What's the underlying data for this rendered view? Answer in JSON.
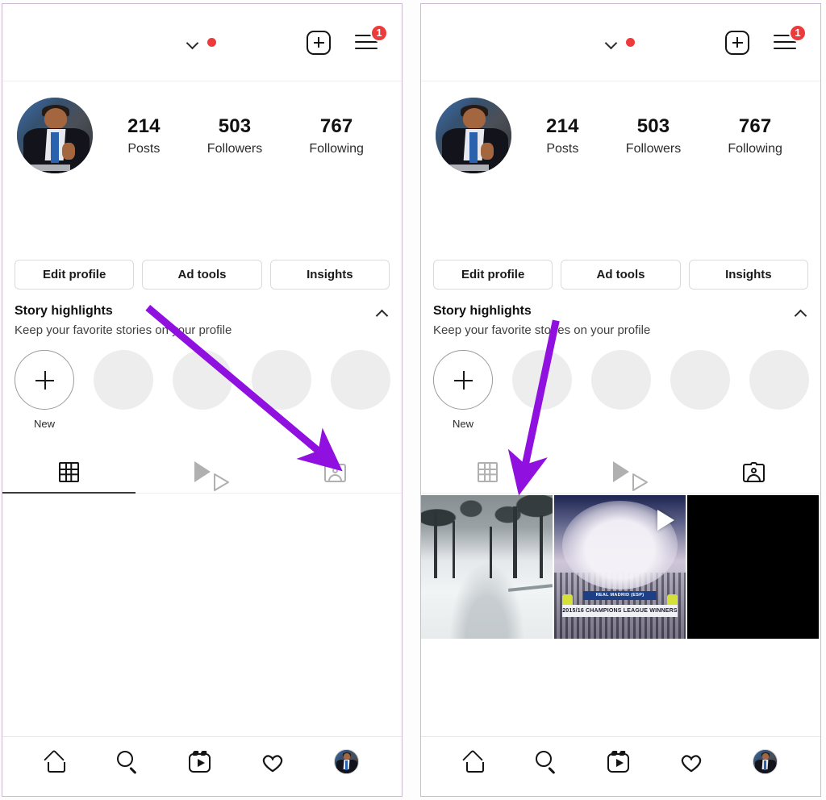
{
  "accent": {
    "arrow_purple": "#9010e0",
    "badge_red": "#ed3a3a",
    "panel_border": "#cdb8d6"
  },
  "panels": [
    {
      "id": "left",
      "topbar": {
        "chevron_icon": "chevron-down-icon",
        "story_dot_icon": "red-dot-indicator",
        "add_icon": "plus-square-icon",
        "menu_icon": "hamburger-menu-icon",
        "menu_badge": "1"
      },
      "profile": {
        "avatar_icon": "profile-avatar",
        "stats": [
          {
            "number": "214",
            "label": "Posts"
          },
          {
            "number": "503",
            "label": "Followers"
          },
          {
            "number": "767",
            "label": "Following"
          }
        ]
      },
      "actions": [
        {
          "label": "Edit profile"
        },
        {
          "label": "Ad tools"
        },
        {
          "label": "Insights"
        }
      ],
      "highlights": {
        "title": "Story highlights",
        "subtitle": "Keep your favorite stories on your profile",
        "collapse_icon": "chevron-up-icon",
        "new_label": "New",
        "empty_count": 4
      },
      "tabs": [
        {
          "icon": "grid-icon",
          "active": true
        },
        {
          "icon": "reels-play-icon",
          "active": false
        },
        {
          "icon": "tagged-person-icon",
          "active": false
        }
      ],
      "posts": [],
      "arrow": {
        "from": "story-highlights-row",
        "to": "tagged-tab"
      }
    },
    {
      "id": "right",
      "topbar": {
        "chevron_icon": "chevron-down-icon",
        "story_dot_icon": "red-dot-indicator",
        "add_icon": "plus-square-icon",
        "menu_icon": "hamburger-menu-icon",
        "menu_badge": "1"
      },
      "profile": {
        "avatar_icon": "profile-avatar",
        "stats": [
          {
            "number": "214",
            "label": "Posts"
          },
          {
            "number": "503",
            "label": "Followers"
          },
          {
            "number": "767",
            "label": "Following"
          }
        ]
      },
      "actions": [
        {
          "label": "Edit profile"
        },
        {
          "label": "Ad tools"
        },
        {
          "label": "Insights"
        }
      ],
      "highlights": {
        "title": "Story highlights",
        "subtitle": "Keep your favorite stories on your profile",
        "collapse_icon": "chevron-up-icon",
        "new_label": "New",
        "empty_count": 4
      },
      "tabs": [
        {
          "icon": "grid-icon",
          "active": false
        },
        {
          "icon": "reels-play-icon",
          "active": false
        },
        {
          "icon": "tagged-person-icon",
          "active": true
        }
      ],
      "posts": [
        {
          "kind": "photo",
          "subject": "snowy-road-with-trees"
        },
        {
          "kind": "video",
          "subject": "football-crowd-celebration",
          "banner_top": "REAL MADRID (ESP)",
          "banner": "2015/16 CHAMPIONS LEAGUE WINNERS",
          "play_icon": "play-overlay-icon"
        },
        {
          "kind": "photo",
          "subject": "black-background-white-text"
        }
      ],
      "arrow": {
        "from": "story-highlights-row",
        "to": "tagged-posts-grid"
      }
    }
  ],
  "bottomnav": [
    {
      "icon": "home-icon",
      "label": "Home"
    },
    {
      "icon": "search-icon",
      "label": "Search"
    },
    {
      "icon": "reels-icon",
      "label": "Reels"
    },
    {
      "icon": "heart-icon",
      "label": "Activity"
    },
    {
      "icon": "profile-avatar-icon",
      "label": "Profile"
    }
  ]
}
